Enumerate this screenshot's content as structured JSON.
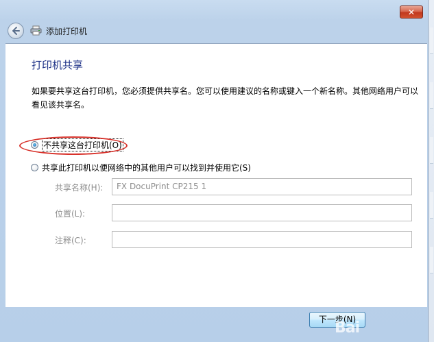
{
  "window": {
    "title": "添加打印机",
    "close_label": "✕"
  },
  "content": {
    "heading": "打印机共享",
    "description": "如果要共享这台打印机，您必须提供共享名。您可以使用建议的名称或键入一个新名称。其他网络用户可以看见该共享名。",
    "options": [
      {
        "label": "不共享这台打印机(O)",
        "checked": true
      },
      {
        "label": "共享此打印机以便网络中的其他用户可以找到并使用它(S)",
        "checked": false
      }
    ],
    "fields": {
      "share_name": {
        "label": "共享名称(H):",
        "value": "FX DocuPrint CP215 1"
      },
      "location": {
        "label": "位置(L):",
        "value": ""
      },
      "comment": {
        "label": "注释(C):",
        "value": ""
      }
    }
  },
  "footer": {
    "next_label": "下一步(N)"
  },
  "watermark": "Bai"
}
